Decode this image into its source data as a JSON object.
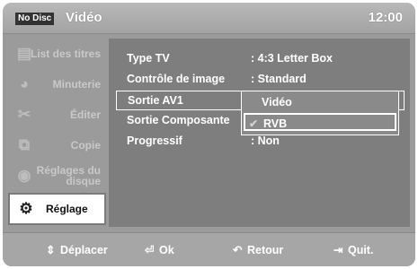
{
  "header": {
    "badge": "No Disc",
    "title": "Vidéo",
    "time": "12:00"
  },
  "sidebar": {
    "items": [
      {
        "label": "List des titres",
        "icon": "film-icon"
      },
      {
        "label": "Minuterie",
        "icon": "timer-icon"
      },
      {
        "label": "Éditer",
        "icon": "scissors-icon"
      },
      {
        "label": "Copie",
        "icon": "copy-icon"
      },
      {
        "label": "Réglages du disque",
        "icon": "disc-settings-icon"
      },
      {
        "label": "Réglage",
        "icon": "gear-icon",
        "active": true
      }
    ]
  },
  "settings": {
    "rows": [
      {
        "label": "Type TV",
        "value": ": 4:3 Letter Box"
      },
      {
        "label": "Contrôle de image",
        "value": ": Standard"
      },
      {
        "label": "Sortie AV1",
        "value": ""
      },
      {
        "label": "Sortie Composante",
        "value": ""
      },
      {
        "label": "Progressif",
        "value": ": Non"
      }
    ],
    "dropdown": {
      "options": [
        "Vidéo",
        "RVB"
      ],
      "selected": "RVB"
    }
  },
  "footer": {
    "move": "Déplacer",
    "ok": "Ok",
    "back": "Retour",
    "quit": "Quit."
  }
}
